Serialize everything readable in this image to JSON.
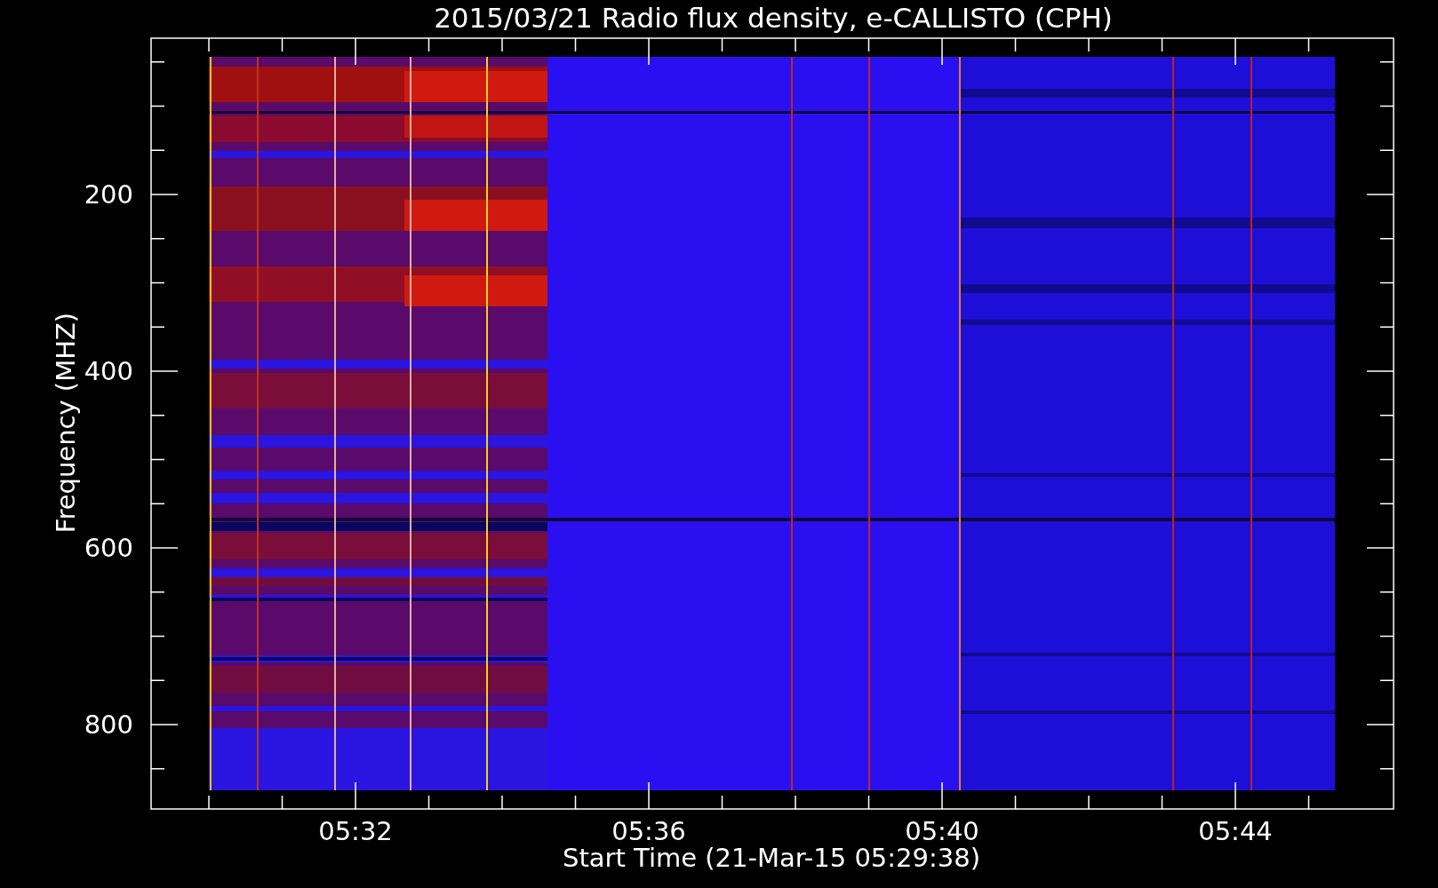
{
  "plot": {
    "title": "2015/03/21  Radio flux density, e-CALLISTO (CPH)",
    "xlabel": "Start Time (21-Mar-15 05:29:38)",
    "ylabel": "Frequency (MHZ)",
    "y_tick_labels": [
      "200",
      "400",
      "600",
      "800"
    ],
    "x_tick_labels": [
      "05:32",
      "05:36",
      "05:40",
      "05:44"
    ]
  }
}
